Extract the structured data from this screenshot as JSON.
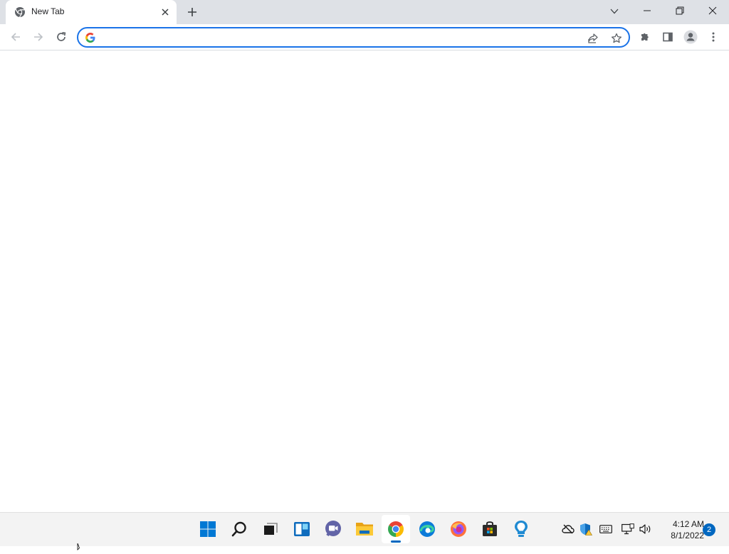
{
  "browser": {
    "tab": {
      "title": "New Tab",
      "icon": "chrome-icon"
    },
    "new_tab_icon": "plus-icon",
    "tab_search_icon": "chevron-down-icon",
    "window_controls": [
      "minimize-icon",
      "restore-icon",
      "close-icon"
    ],
    "toolbar": {
      "back_icon": "arrow-left-icon",
      "forward_icon": "arrow-right-icon",
      "reload_icon": "reload-icon",
      "omnibox": {
        "value": "",
        "placeholder": "",
        "search_engine_icon": "google-g-icon"
      },
      "share_icon": "share-icon",
      "bookmark_icon": "star-icon",
      "extensions_icon": "puzzle-icon",
      "side_panel_icon": "side-panel-icon",
      "profile_icon": "avatar-icon",
      "menu_icon": "kebab-menu-icon"
    },
    "accent_color": "#1a73e8"
  },
  "taskbar": {
    "apps": [
      "start",
      "search",
      "task-view",
      "widgets",
      "chat",
      "file-explorer",
      "chrome",
      "edge",
      "firefox",
      "microsoft-store",
      "tips"
    ],
    "active_app": "chrome",
    "tray_icons": [
      "cloud-offline-icon",
      "windows-security-icon",
      "touch-keyboard-icon",
      "network-icon",
      "volume-icon"
    ],
    "clock": {
      "time": "4:12 AM",
      "date": "8/1/2022"
    },
    "notifications_count": "2",
    "accent_color": "#0067c0"
  }
}
